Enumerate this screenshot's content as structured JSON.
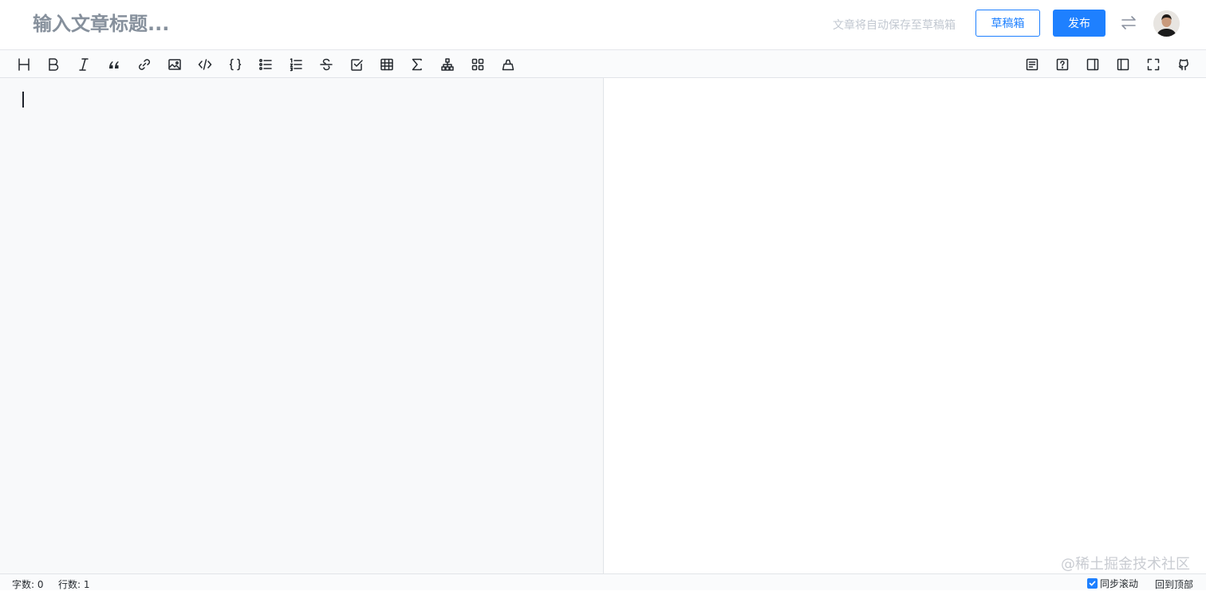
{
  "header": {
    "title_placeholder": "输入文章标题...",
    "save_hint": "文章将自动保存至草稿箱",
    "draft_button": "草稿箱",
    "publish_button": "发布"
  },
  "toolbar": {
    "left_tools": [
      {
        "name": "heading",
        "icon": "heading-icon",
        "glyph": "H"
      },
      {
        "name": "bold",
        "icon": "bold-icon",
        "glyph": "B"
      },
      {
        "name": "italic",
        "icon": "italic-icon",
        "glyph": "I"
      },
      {
        "name": "quote",
        "icon": "quote-icon",
        "glyph": "“"
      },
      {
        "name": "link",
        "icon": "link-icon"
      },
      {
        "name": "image",
        "icon": "image-icon"
      },
      {
        "name": "inline-code",
        "icon": "code-icon"
      },
      {
        "name": "code-block",
        "icon": "code-block-icon",
        "glyph": "{ }"
      },
      {
        "name": "unordered-list",
        "icon": "bullet-list-icon"
      },
      {
        "name": "ordered-list",
        "icon": "ordered-list-icon"
      },
      {
        "name": "strikethrough",
        "icon": "strikethrough-icon"
      },
      {
        "name": "task-list",
        "icon": "checkbox-icon"
      },
      {
        "name": "table",
        "icon": "table-icon"
      },
      {
        "name": "math",
        "icon": "sigma-icon",
        "glyph": "Σ"
      },
      {
        "name": "mermaid",
        "icon": "diagram-icon"
      },
      {
        "name": "plugins",
        "icon": "grid-icon"
      },
      {
        "name": "theme",
        "icon": "clear-icon"
      }
    ],
    "right_tools": [
      {
        "name": "toc",
        "icon": "toc-icon"
      },
      {
        "name": "help",
        "icon": "help-icon"
      },
      {
        "name": "preview-only",
        "icon": "sidebar-right-icon"
      },
      {
        "name": "editor-only",
        "icon": "sidebar-left-icon"
      },
      {
        "name": "fullscreen",
        "icon": "fullscreen-icon"
      },
      {
        "name": "github",
        "icon": "github-icon"
      }
    ]
  },
  "editor": {
    "watermark": "@稀土掘金技术社区"
  },
  "status": {
    "word_count": "字数: 0",
    "line_count": "行数: 1",
    "sync_scroll": "同步滚动",
    "sync_scroll_checked": true,
    "back_to_top": "回到顶部"
  },
  "colors": {
    "accent": "#1e80ff",
    "editor_bg": "#f8f9fa",
    "toolbar_bg": "#fafbfc"
  }
}
